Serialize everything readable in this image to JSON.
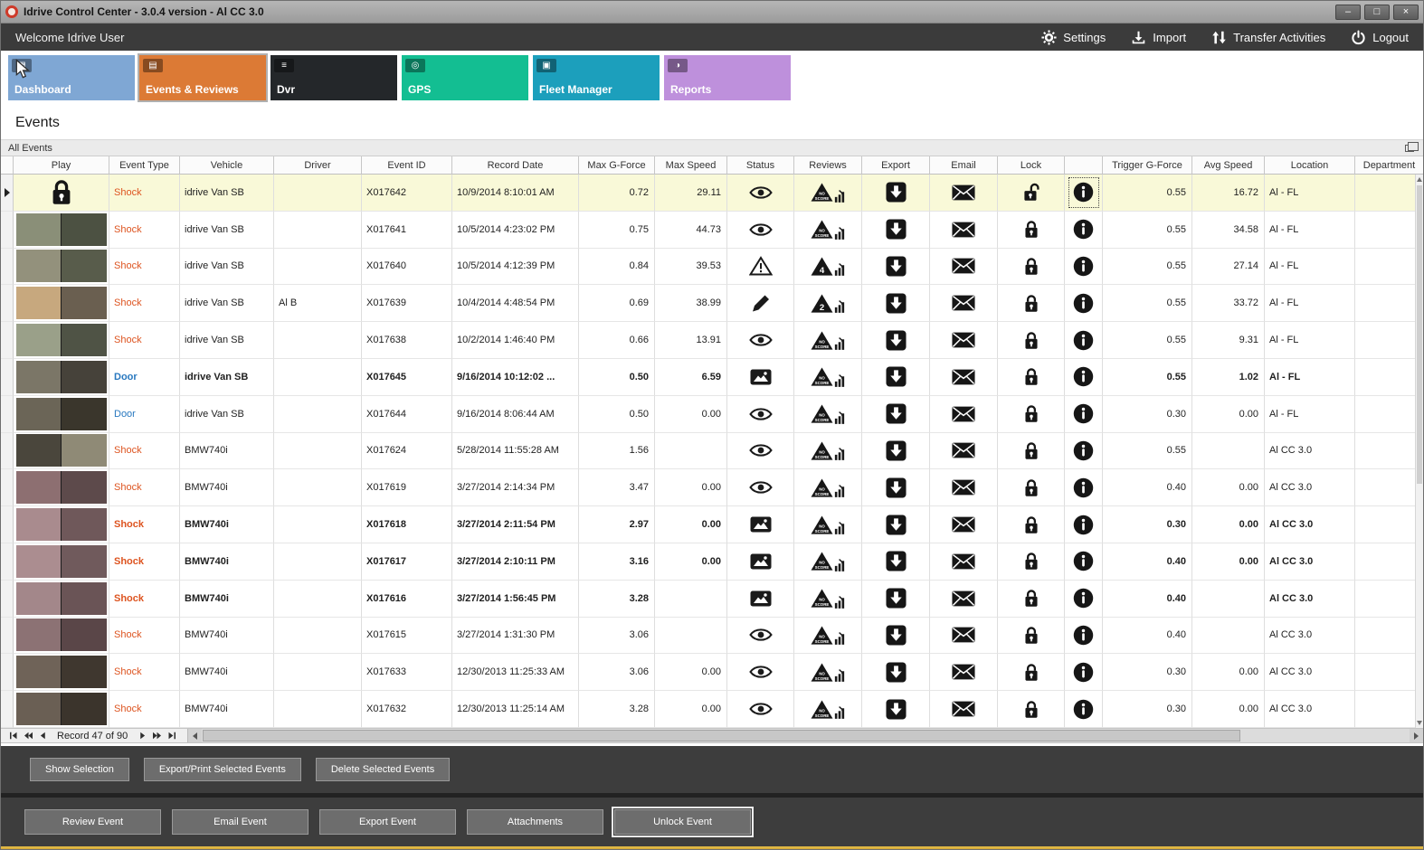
{
  "window": {
    "title": "Idrive Control Center - 3.0.4 version - Al CC 3.0",
    "controls": {
      "minimize": "–",
      "maximize": "□",
      "close": "×"
    }
  },
  "topbar": {
    "welcome": "Welcome Idrive User",
    "actions": [
      {
        "label": "Settings",
        "icon": "gear-icon"
      },
      {
        "label": "Import",
        "icon": "import-icon"
      },
      {
        "label": "Transfer Activities",
        "icon": "transfer-icon"
      },
      {
        "label": "Logout",
        "icon": "power-icon"
      }
    ]
  },
  "tabs": [
    {
      "label": "Dashboard",
      "glyph": "▦",
      "color": "#7fa7d4",
      "selected": false
    },
    {
      "label": "Events & Reviews",
      "glyph": "▤",
      "color": "#dc7a35",
      "selected": true
    },
    {
      "label": "Dvr",
      "glyph": "≡",
      "color": "#24272a",
      "selected": false
    },
    {
      "label": "GPS",
      "glyph": "◎",
      "color": "#13be92",
      "selected": false
    },
    {
      "label": "Fleet Manager",
      "glyph": "▣",
      "color": "#1c9fbc",
      "selected": false
    },
    {
      "label": "Reports",
      "glyph": "◑",
      "color": "#be90dc",
      "selected": false
    }
  ],
  "page": {
    "heading": "Events",
    "group_caption": "All Events"
  },
  "table": {
    "columns": [
      "",
      "Play",
      "Event Type",
      "Vehicle",
      "Driver",
      "Event ID",
      "Record Date",
      "Max G-Force",
      "Max Speed",
      "Status",
      "Reviews",
      "Export",
      "Email",
      "Lock",
      "",
      "Trigger G-Force",
      "Avg Speed",
      "Location",
      "Department"
    ],
    "type_colors": {
      "Shock": "#dd5420",
      "Door": "#2878bf"
    },
    "rows": [
      {
        "selected": true,
        "bold": false,
        "play": "lock",
        "thumb": null,
        "type": "Shock",
        "vehicle": "idrive Van SB",
        "driver": "",
        "id": "X017642",
        "date": "10/9/2014 8:10:01 AM",
        "maxg": "0.72",
        "maxspd": "29.11",
        "status": "eye",
        "score": "NO SCORE",
        "lock": "unlock",
        "trig": "0.55",
        "avg": "16.72",
        "loc": "Al - FL",
        "dept": ""
      },
      {
        "selected": false,
        "bold": false,
        "play": "thumb",
        "thumb": [
          "#8a8f78",
          "#4c5142"
        ],
        "type": "Shock",
        "vehicle": "idrive Van SB",
        "driver": "",
        "id": "X017641",
        "date": "10/5/2014 4:23:02 PM",
        "maxg": "0.75",
        "maxspd": "44.73",
        "status": "eye",
        "score": "NO SCORE",
        "lock": "lock",
        "trig": "0.55",
        "avg": "34.58",
        "loc": "Al - FL",
        "dept": ""
      },
      {
        "selected": false,
        "bold": false,
        "play": "thumb",
        "thumb": [
          "#93917c",
          "#585c4b"
        ],
        "type": "Shock",
        "vehicle": "idrive Van SB",
        "driver": "",
        "id": "X017640",
        "date": "10/5/2014 4:12:39 PM",
        "maxg": "0.84",
        "maxspd": "39.53",
        "status": "warning",
        "score": "4",
        "lock": "lock",
        "trig": "0.55",
        "avg": "27.14",
        "loc": "Al - FL",
        "dept": ""
      },
      {
        "selected": false,
        "bold": false,
        "play": "thumb",
        "thumb": [
          "#c7a87e",
          "#6a5f50"
        ],
        "type": "Shock",
        "vehicle": "idrive Van SB",
        "driver": "Al B",
        "id": "X017639",
        "date": "10/4/2014 4:48:54 PM",
        "maxg": "0.69",
        "maxspd": "38.99",
        "status": "pencil",
        "score": "2",
        "lock": "lock",
        "trig": "0.55",
        "avg": "33.72",
        "loc": "Al - FL",
        "dept": ""
      },
      {
        "selected": false,
        "bold": false,
        "play": "thumb",
        "thumb": [
          "#9aa089",
          "#4f5345"
        ],
        "type": "Shock",
        "vehicle": "idrive Van SB",
        "driver": "",
        "id": "X017638",
        "date": "10/2/2014 1:46:40 PM",
        "maxg": "0.66",
        "maxspd": "13.91",
        "status": "eye",
        "score": "NO SCORE",
        "lock": "lock",
        "trig": "0.55",
        "avg": "9.31",
        "loc": "Al - FL",
        "dept": ""
      },
      {
        "selected": false,
        "bold": true,
        "play": "thumb",
        "thumb": [
          "#7b7667",
          "#46423a"
        ],
        "type": "Door",
        "vehicle": "idrive Van SB",
        "driver": "",
        "id": "X017645",
        "date": "9/16/2014 10:12:02 ...",
        "maxg": "0.50",
        "maxspd": "6.59",
        "status": "image",
        "score": "NO SCORE",
        "lock": "lock",
        "trig": "0.55",
        "avg": "1.02",
        "loc": "Al - FL",
        "dept": ""
      },
      {
        "selected": false,
        "bold": false,
        "play": "thumb",
        "thumb": [
          "#6b6557",
          "#3a362c"
        ],
        "type": "Door",
        "vehicle": "idrive Van SB",
        "driver": "",
        "id": "X017644",
        "date": "9/16/2014 8:06:44 AM",
        "maxg": "0.50",
        "maxspd": "0.00",
        "status": "eye",
        "score": "NO SCORE",
        "lock": "lock",
        "trig": "0.30",
        "avg": "0.00",
        "loc": "Al - FL",
        "dept": ""
      },
      {
        "selected": false,
        "bold": false,
        "play": "thumb",
        "thumb": [
          "#4a463c",
          "#8f8a76"
        ],
        "type": "Shock",
        "vehicle": "BMW740i",
        "driver": "",
        "id": "X017624",
        "date": "5/28/2014 11:55:28 AM",
        "maxg": "1.56",
        "maxspd": "",
        "status": "eye",
        "score": "NO SCORE",
        "lock": "lock",
        "trig": "0.55",
        "avg": "",
        "loc": "Al CC 3.0",
        "dept": ""
      },
      {
        "selected": false,
        "bold": false,
        "play": "thumb",
        "thumb": [
          "#8d6f71",
          "#5d4a4b"
        ],
        "type": "Shock",
        "vehicle": "BMW740i",
        "driver": "",
        "id": "X017619",
        "date": "3/27/2014 2:14:34 PM",
        "maxg": "3.47",
        "maxspd": "0.00",
        "status": "eye",
        "score": "NO SCORE",
        "lock": "lock",
        "trig": "0.40",
        "avg": "0.00",
        "loc": "Al CC 3.0",
        "dept": ""
      },
      {
        "selected": false,
        "bold": true,
        "play": "thumb",
        "thumb": [
          "#a98b8e",
          "#6f585a"
        ],
        "type": "Shock",
        "vehicle": "BMW740i",
        "driver": "",
        "id": "X017618",
        "date": "3/27/2014 2:11:54 PM",
        "maxg": "2.97",
        "maxspd": "0.00",
        "status": "image",
        "score": "NO SCORE",
        "lock": "lock",
        "trig": "0.30",
        "avg": "0.00",
        "loc": "Al CC 3.0",
        "dept": ""
      },
      {
        "selected": false,
        "bold": true,
        "play": "thumb",
        "thumb": [
          "#ab8d90",
          "#705a5c"
        ],
        "type": "Shock",
        "vehicle": "BMW740i",
        "driver": "",
        "id": "X017617",
        "date": "3/27/2014 2:10:11 PM",
        "maxg": "3.16",
        "maxspd": "0.00",
        "status": "image",
        "score": "NO SCORE",
        "lock": "lock",
        "trig": "0.40",
        "avg": "0.00",
        "loc": "Al CC 3.0",
        "dept": ""
      },
      {
        "selected": false,
        "bold": true,
        "play": "thumb",
        "thumb": [
          "#a3878a",
          "#6a5456"
        ],
        "type": "Shock",
        "vehicle": "BMW740i",
        "driver": "",
        "id": "X017616",
        "date": "3/27/2014 1:56:45 PM",
        "maxg": "3.28",
        "maxspd": "",
        "status": "image",
        "score": "NO SCORE",
        "lock": "lock",
        "trig": "0.40",
        "avg": "",
        "loc": "Al CC 3.0",
        "dept": ""
      },
      {
        "selected": false,
        "bold": false,
        "play": "thumb",
        "thumb": [
          "#8c7274",
          "#5a4648"
        ],
        "type": "Shock",
        "vehicle": "BMW740i",
        "driver": "",
        "id": "X017615",
        "date": "3/27/2014 1:31:30 PM",
        "maxg": "3.06",
        "maxspd": "",
        "status": "eye",
        "score": "NO SCORE",
        "lock": "lock",
        "trig": "0.40",
        "avg": "",
        "loc": "Al CC 3.0",
        "dept": ""
      },
      {
        "selected": false,
        "bold": false,
        "play": "thumb",
        "thumb": [
          "#6f6358",
          "#3f372f"
        ],
        "type": "Shock",
        "vehicle": "BMW740i",
        "driver": "",
        "id": "X017633",
        "date": "12/30/2013 11:25:33 AM",
        "maxg": "3.06",
        "maxspd": "0.00",
        "status": "eye",
        "score": "NO SCORE",
        "lock": "lock",
        "trig": "0.30",
        "avg": "0.00",
        "loc": "Al CC 3.0",
        "dept": ""
      },
      {
        "selected": false,
        "bold": false,
        "play": "thumb",
        "thumb": [
          "#6a5f54",
          "#3b342c"
        ],
        "type": "Shock",
        "vehicle": "BMW740i",
        "driver": "",
        "id": "X017632",
        "date": "12/30/2013 11:25:14 AM",
        "maxg": "3.28",
        "maxspd": "0.00",
        "status": "eye",
        "score": "NO SCORE",
        "lock": "lock",
        "trig": "0.30",
        "avg": "0.00",
        "loc": "Al CC 3.0",
        "dept": ""
      }
    ]
  },
  "record_nav": {
    "label": "Record 47 of 90"
  },
  "selection_panel": {
    "buttons": [
      "Show Selection",
      "Export/Print Selected Events",
      "Delete Selected Events"
    ]
  },
  "action_panel": {
    "buttons": [
      "Review Event",
      "Email Event",
      "Export Event",
      "Attachments",
      "Unlock Event"
    ],
    "focused_index": 4
  }
}
